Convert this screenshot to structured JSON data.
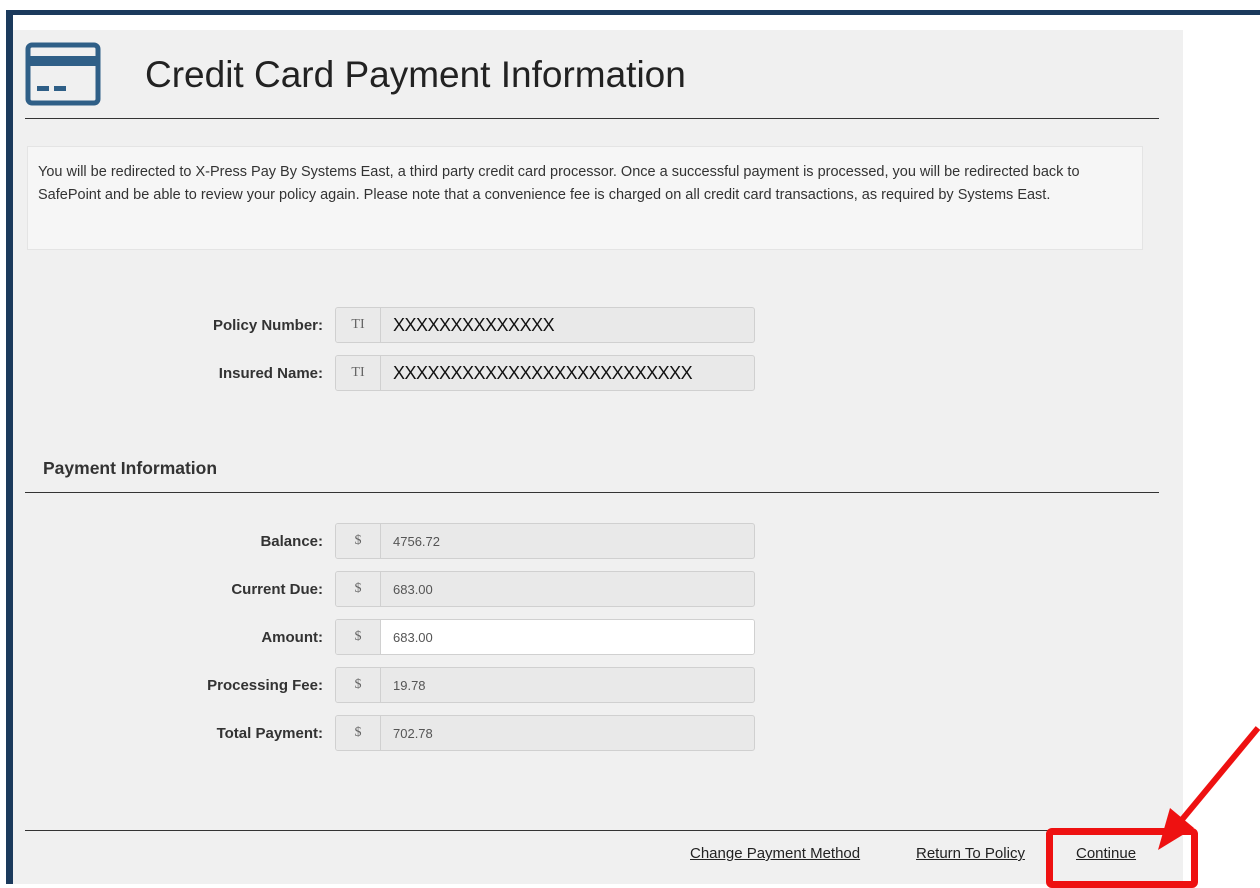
{
  "header": {
    "title": "Credit Card Payment Information",
    "icon": "credit-card-icon"
  },
  "notice": {
    "text": "You will be redirected to X-Press Pay By Systems East, a third party credit card processor. Once a successful payment is processed, you will be redirected back to SafePoint and be able to review your policy again. Please note that a convenience fee is charged on all credit card transactions, as required by Systems East."
  },
  "policy": {
    "number_label": "Policy Number:",
    "number_addon": "TI",
    "number_value": "XXXXXXXXXXXXXX",
    "insured_label": "Insured Name:",
    "insured_addon": "TI",
    "insured_value": "XXXXXXXXXXXXXXXXXXXXXXXXXX"
  },
  "payment": {
    "section_title": "Payment Information",
    "currency_symbol": "$",
    "balance_label": "Balance:",
    "balance_value": "4756.72",
    "current_due_label": "Current Due:",
    "current_due_value": "683.00",
    "amount_label": "Amount:",
    "amount_value": "683.00",
    "fee_label": "Processing Fee:",
    "fee_value": "19.78",
    "total_label": "Total Payment:",
    "total_value": "702.78"
  },
  "footer": {
    "change_method_label": "Change Payment Method",
    "return_label": "Return To Policy",
    "continue_label": "Continue"
  },
  "colors": {
    "frame": "#1b3a5c",
    "icon": "#2f5f87",
    "highlight": "#ee1111"
  }
}
